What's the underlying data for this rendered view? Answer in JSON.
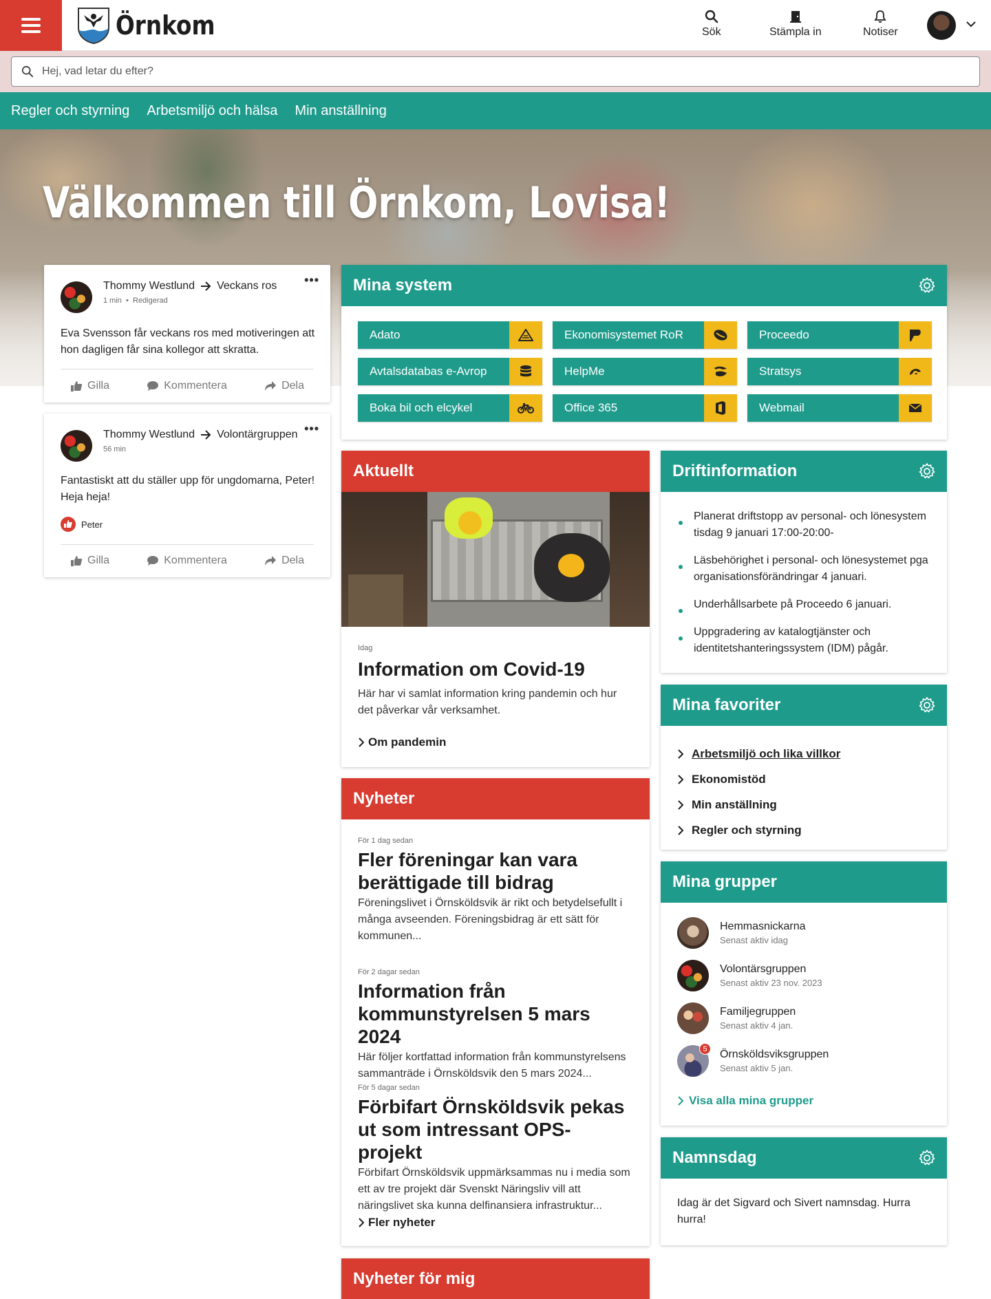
{
  "header": {
    "logo_text": "Örnkom",
    "actions": {
      "search": "Sök",
      "stamp": "Stämpla in",
      "notifications": "Notiser"
    }
  },
  "search": {
    "placeholder": "Hej, vad letar du efter?"
  },
  "nav": {
    "items": [
      "Regler och styrning",
      "Arbetsmiljö och hälsa",
      "Min anställning"
    ]
  },
  "hero": {
    "title": "Välkommen till Örnkom, Lovisa!"
  },
  "feed": {
    "posts": [
      {
        "author": "Thommy Westlund",
        "target": "Veckans ros",
        "meta_time": "1 min",
        "meta_edited": "Redigerad",
        "text": "Eva Svensson får veckans ros med motiveringen att hon dagligen får sina kollegor att skratta.",
        "like": "Gilla",
        "comment": "Kommentera",
        "share": "Dela"
      },
      {
        "author": "Thommy Westlund",
        "target": "Volontärgruppen",
        "meta_time": "56 min",
        "text": "Fantastiskt att du ställer upp för ungdomarna, Peter! Heja heja!",
        "liker": "Peter",
        "like": "Gilla",
        "comment": "Kommentera",
        "share": "Dela"
      }
    ]
  },
  "systems": {
    "title": "Mina system",
    "items": [
      {
        "label": "Adato",
        "icon": "adato-icon"
      },
      {
        "label": "Ekonomisystemet RoR",
        "icon": "economy-icon"
      },
      {
        "label": "Proceedo",
        "icon": "proceedo-icon"
      },
      {
        "label": "Avtalsdatabas e-Avrop",
        "icon": "database-icon"
      },
      {
        "label": "HelpMe",
        "icon": "helpme-icon"
      },
      {
        "label": "Stratsys",
        "icon": "stratsys-icon"
      },
      {
        "label": "Boka bil och elcykel",
        "icon": "bicycle-icon"
      },
      {
        "label": "Office 365",
        "icon": "office-icon"
      },
      {
        "label": "Webmail",
        "icon": "mail-icon"
      }
    ]
  },
  "aktuellt": {
    "title": "Aktuellt",
    "date": "Idag",
    "headline": "Information om Covid-19",
    "body": "Här har vi samlat information kring pandemin och hur det påverkar vår verksamhet.",
    "link": "Om pandemin"
  },
  "nyheter": {
    "title": "Nyheter",
    "items": [
      {
        "when": "För 1 dag sedan",
        "headline": "Fler föreningar kan vara berättigade till bidrag",
        "body": "Föreningslivet i Örnsköldsvik är rikt och betydelsefullt i många avseenden. Föreningsbidrag är ett sätt för kommunen..."
      },
      {
        "when": "För 2 dagar sedan",
        "headline": "Information från kommunstyrelsen 5 mars 2024",
        "body": "Här följer kortfattad information från kommunstyrelsens sammanträde i Örnsköldsvik den 5 mars 2024..."
      },
      {
        "when": "För 5 dagar sedan",
        "headline": "Förbifart Örnsköldsvik pekas ut som intressant OPS-projekt",
        "body": "Förbifart Örnsköldsvik uppmärksammas nu i media som ett av tre projekt där Svenskt Näringsliv vill att näringslivet ska kunna delfinansiera infrastruktur..."
      }
    ],
    "link": "Fler nyheter"
  },
  "nyheter_for_mig": {
    "title": "Nyheter för mig"
  },
  "drift": {
    "title": "Driftinformation",
    "items": [
      "Planerat driftstopp av personal- och lönesystem tisdag 9 januari 17:00-20:00-",
      "Läsbehörighet i personal- och lönesystemet pga organisationsförändringar 4 januari.",
      "Underhållsarbete på Proceedo 6 januari.",
      "Uppgradering av katalogtjänster och identitetshanteringssystem (IDM) pågår."
    ]
  },
  "favoriter": {
    "title": "Mina favoriter",
    "items": [
      "Arbetsmiljö och lika villkor",
      "Ekonomistöd",
      "Min anställning",
      "Regler och styrning"
    ]
  },
  "grupper": {
    "title": "Mina grupper",
    "items": [
      {
        "name": "Hemmasnickarna",
        "sub": "Senast aktiv idag"
      },
      {
        "name": "Volontärsgruppen",
        "sub": "Senast aktiv 23 nov. 2023"
      },
      {
        "name": "Familjegruppen",
        "sub": "Senast aktiv 4 jan."
      },
      {
        "name": "Örnsköldsviksgruppen",
        "sub": "Senast aktiv 5 jan.",
        "badge": "5"
      }
    ],
    "link": "Visa alla mina grupper"
  },
  "namnsdag": {
    "title": "Namnsdag",
    "text": "Idag är det Sigvard och Sivert namnsdag. Hurra hurra!"
  },
  "colors": {
    "teal": "#1f9b8c",
    "red": "#d83b2f",
    "yellow": "#f0b818"
  }
}
